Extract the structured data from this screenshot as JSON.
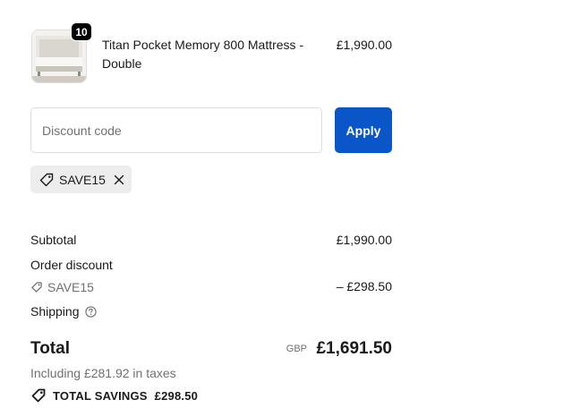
{
  "line_item": {
    "quantity": "10",
    "name": "Titan Pocket Memory 800 Mattress - Double",
    "price": "£1,990.00"
  },
  "discount": {
    "placeholder": "Discount code",
    "apply_label": "Apply",
    "applied_code": "SAVE15"
  },
  "summary": {
    "subtotal_label": "Subtotal",
    "subtotal_value": "£1,990.00",
    "order_discount_label": "Order discount",
    "discount_code": "SAVE15",
    "discount_value": "– £298.50",
    "shipping_label": "Shipping",
    "total_label": "Total",
    "currency": "GBP",
    "total_value": "£1,691.50",
    "taxes_note": "Including £281.92 in taxes",
    "savings_label": "TOTAL SAVINGS",
    "savings_value": "£298.50"
  },
  "colors": {
    "accent": "#0a56c8",
    "chip_bg": "#ededed",
    "muted_text": "#707070"
  },
  "icons": [
    "tag-icon",
    "close-icon",
    "help-circle-icon"
  ]
}
